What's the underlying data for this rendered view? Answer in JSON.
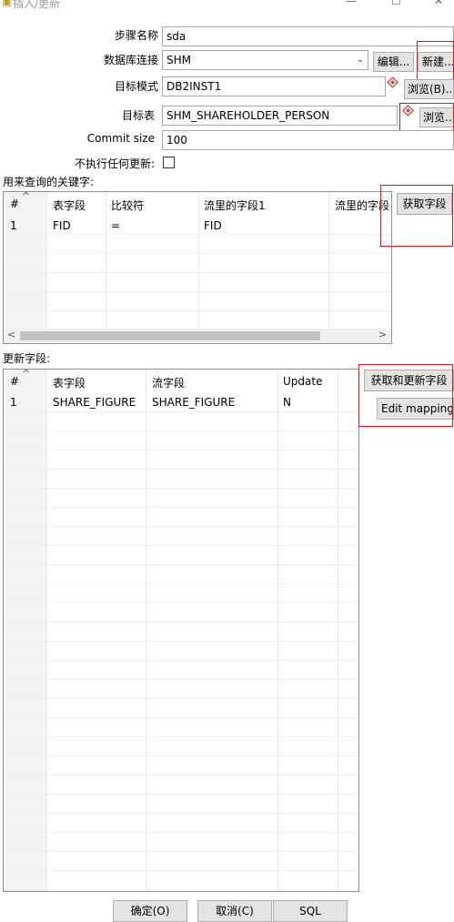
{
  "window": {
    "title": "插入/更新"
  },
  "form": {
    "step_name_label": "步骤名称",
    "step_name_value": "sda",
    "db_conn_label": "数据库连接",
    "db_conn_value": "SHM",
    "edit_label": "编辑...",
    "new_label": "新建...",
    "target_schema_label": "目标模式",
    "target_schema_value": "DB2INST1",
    "browse_b_label": "浏览(B)...",
    "target_table_label": "目标表",
    "target_table_value": "SHM_SHAREHOLDER_PERSON",
    "browse_label": "浏览...",
    "commit_size_label": "Commit size",
    "commit_size_value": "100",
    "no_update_label": "不执行任何更新:",
    "no_update_checked": false
  },
  "key_section": {
    "label": "用来查询的关键字:",
    "columns": [
      "#",
      "表字段",
      "比较符",
      "流里的字段1",
      "流里的字段"
    ],
    "rows": [
      [
        "1",
        "FID",
        "=",
        "FID",
        ""
      ]
    ],
    "get_fields_label": "获取字段"
  },
  "update_section": {
    "label": "更新字段:",
    "columns": [
      "#",
      "表字段",
      "流字段",
      "Update"
    ],
    "rows": [
      [
        "1",
        "SHARE_FIGURE",
        "SHARE_FIGURE",
        "N"
      ]
    ],
    "get_update_label": "获取和更新字段",
    "edit_mapping_label": "Edit mapping"
  },
  "footer": {
    "ok": "确定(O)",
    "cancel": "取消(C)",
    "sql": "SQL"
  },
  "colors": {
    "highlight": "#e8141b",
    "button_bg": "#e3e3e3",
    "border": "#8e8e8e"
  }
}
